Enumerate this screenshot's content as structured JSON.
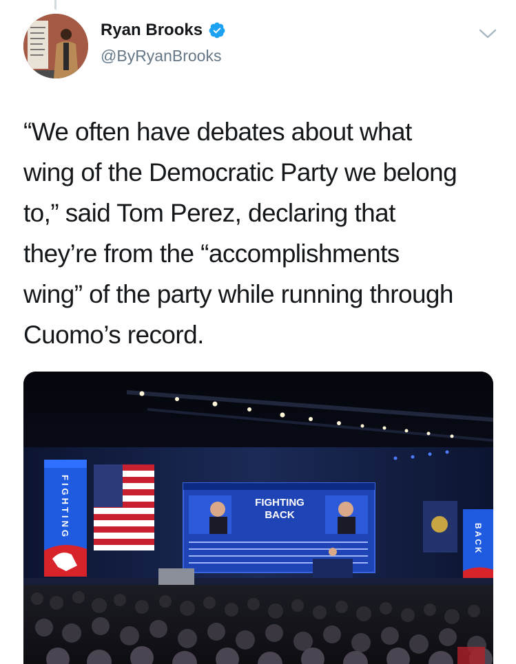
{
  "thread": {
    "has_parent": true
  },
  "author": {
    "display_name": "Ryan Brooks",
    "handle": "@ByRyanBrooks",
    "verified": true,
    "avatar_icon": "avatar-photo"
  },
  "tweet": {
    "text_lines": [
      "“We often have debates about what",
      "wing of the Democratic Party we belong",
      "to,” said Tom Perez, declaring that",
      "they’re from the “accomplishments",
      "wing” of the party while running through",
      "Cuomo’s record."
    ]
  },
  "media": {
    "screen_title_line1": "FIGHTING",
    "screen_title_line2": "BACK",
    "left_banner_text": "FIGHTING",
    "right_banner_text": "BACK"
  },
  "menu_icon": "chevron-down-icon",
  "colors": {
    "verified_blue": "#1da1f2",
    "handle_gray": "#657786",
    "text_dark": "#14171a"
  }
}
